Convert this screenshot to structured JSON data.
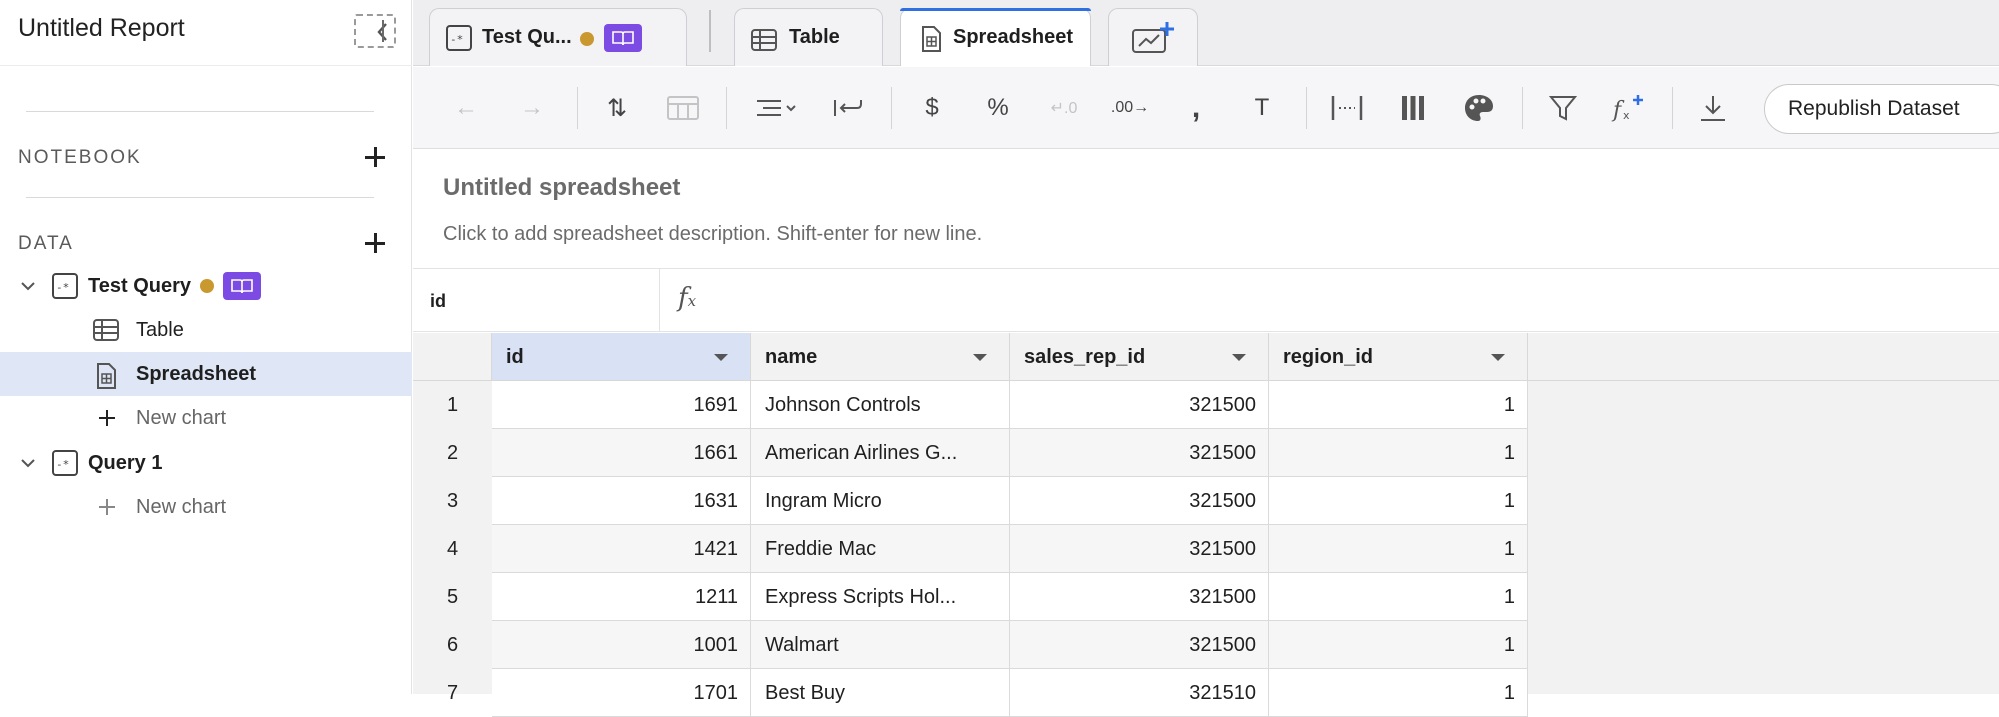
{
  "sidebar": {
    "report_title": "Untitled Report",
    "notebook_label": "NOTEBOOK",
    "data_label": "DATA",
    "items": [
      {
        "label": "Test Query"
      },
      {
        "label": "Table"
      },
      {
        "label": "Spreadsheet"
      },
      {
        "label": "New chart"
      },
      {
        "label": "Query 1"
      },
      {
        "label": "New chart"
      }
    ]
  },
  "tabs": [
    {
      "label": "Test Qu..."
    },
    {
      "label": "Table"
    },
    {
      "label": "Spreadsheet"
    }
  ],
  "toolbar": {
    "republish_label": "Republish Dataset",
    "icons": [
      "undo-icon",
      "redo-icon",
      "sort-icon",
      "table-layout-icon",
      "align-icon",
      "wrap-icon",
      "dollar-icon",
      "percent-icon",
      "decrease-decimal-icon",
      "increase-decimal-icon",
      "comma-icon",
      "text-format-icon",
      "column-width-icon",
      "columns-icon",
      "palette-icon",
      "filter-icon",
      "add-formula-icon",
      "download-icon"
    ]
  },
  "spreadsheet": {
    "title": "Untitled spreadsheet",
    "description": "Click to add spreadsheet description. Shift-enter for new line.",
    "cell_ref": "id",
    "columns": [
      "id",
      "name",
      "sales_rep_id",
      "region_id"
    ],
    "rows": [
      [
        "1",
        "1691",
        "Johnson Controls",
        "321500",
        "1"
      ],
      [
        "2",
        "1661",
        "American Airlines G...",
        "321500",
        "1"
      ],
      [
        "3",
        "1631",
        "Ingram Micro",
        "321500",
        "1"
      ],
      [
        "4",
        "1421",
        "Freddie Mac",
        "321500",
        "1"
      ],
      [
        "5",
        "1211",
        "Express Scripts Hol...",
        "321500",
        "1"
      ],
      [
        "6",
        "1001",
        "Walmart",
        "321500",
        "1"
      ],
      [
        "7",
        "1701",
        "Best Buy",
        "321510",
        "1"
      ]
    ]
  },
  "colors": {
    "accent_blue": "#2f6fe4",
    "badge_purple": "#7c4be3",
    "status_dot": "#c9982f",
    "selected_row": "#dfe6f5"
  }
}
